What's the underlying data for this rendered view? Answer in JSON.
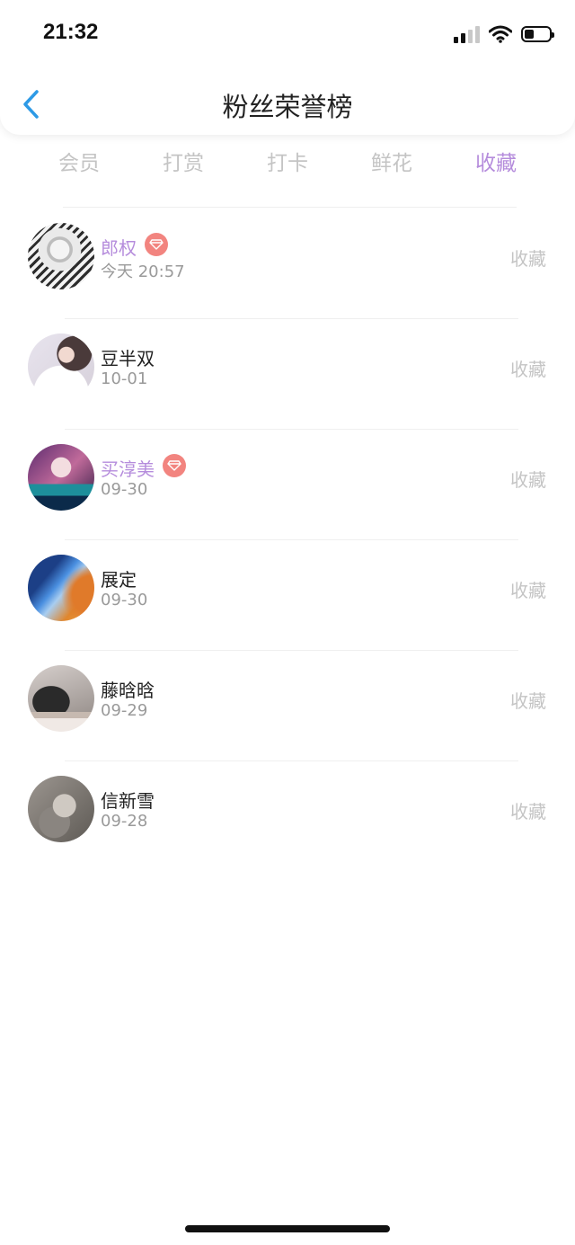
{
  "status_bar": {
    "time": "21:32"
  },
  "nav": {
    "title": "粉丝荣誉榜"
  },
  "tabs": [
    {
      "label": "会员",
      "active": false
    },
    {
      "label": "打赏",
      "active": false
    },
    {
      "label": "打卡",
      "active": false
    },
    {
      "label": "鲜花",
      "active": false
    },
    {
      "label": "收藏",
      "active": true
    }
  ],
  "colors": {
    "accent": "#b58cdc",
    "back_arrow": "#2d9ae6",
    "badge": "#f2847f",
    "muted": "#c4c4c4"
  },
  "fans": [
    {
      "name": "郎权",
      "date": "今天 20:57",
      "vip": true,
      "action": "收藏"
    },
    {
      "name": "豆半双",
      "date": "10-01",
      "vip": false,
      "action": "收藏"
    },
    {
      "name": "买淳美",
      "date": "09-30",
      "vip": true,
      "action": "收藏"
    },
    {
      "name": "展定",
      "date": "09-30",
      "vip": false,
      "action": "收藏"
    },
    {
      "name": "藤晗晗",
      "date": "09-29",
      "vip": false,
      "action": "收藏"
    },
    {
      "name": "信新雪",
      "date": "09-28",
      "vip": false,
      "action": "收藏"
    }
  ]
}
